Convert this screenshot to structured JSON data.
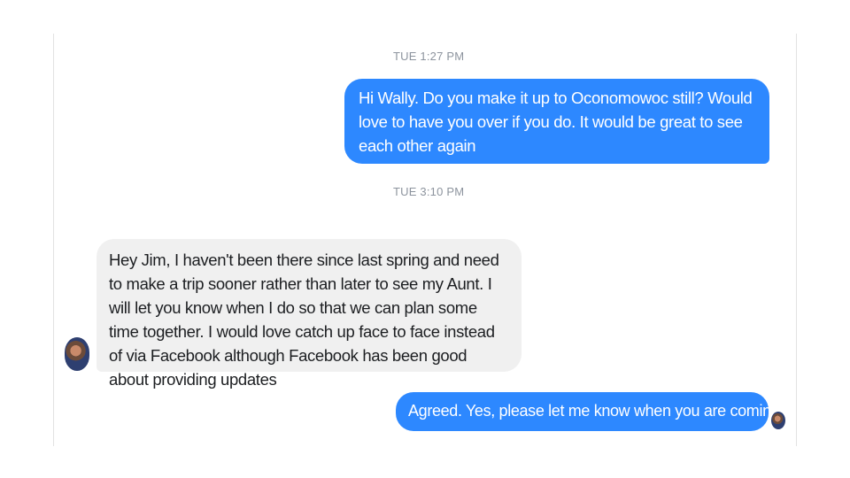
{
  "conversation": {
    "messages": [
      {
        "timestamp": "TUE 1:27 PM",
        "direction": "outgoing",
        "text": "Hi Wally.  Do you make it up to Oconomowoc still?  Would love to have you over if you do.  It would be great to see each other again"
      },
      {
        "timestamp": "TUE 3:10 PM",
        "direction": "incoming",
        "text": "Hey Jim, I haven't been there since last spring and need to make a trip sooner rather than later to see my Aunt.  I will let you know when I do so that we can plan some time together.  I would love catch up face to face instead of via Facebook although Facebook has been good about providing updates"
      },
      {
        "direction": "outgoing",
        "text": "Agreed. Yes, please let me know when you are coming."
      }
    ]
  },
  "colors": {
    "outgoing_bubble": "#2d88ff",
    "incoming_bubble": "#f0f0f0",
    "timestamp_text": "#8d949e"
  }
}
